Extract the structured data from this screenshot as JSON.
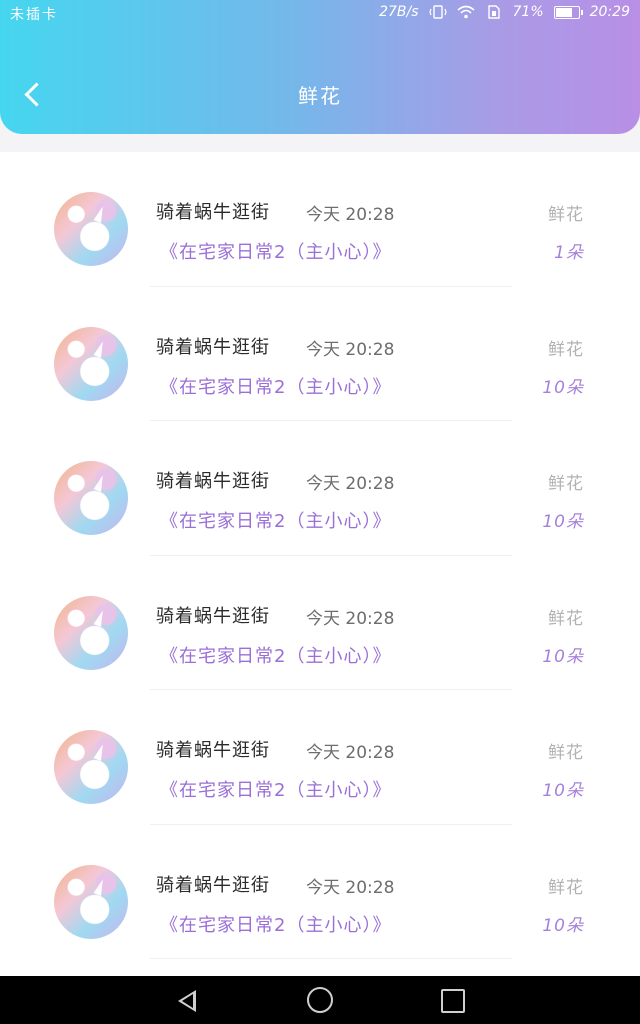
{
  "status_bar": {
    "carrier": "未插卡",
    "net_speed": "27B/s",
    "battery_percent": "71%",
    "time": "20:29",
    "icons": [
      "vibrate-icon",
      "wifi-icon",
      "sim-icon",
      "battery-icon"
    ]
  },
  "header": {
    "title": "鲜花",
    "gradient": [
      "#45d6ef",
      "#b88fe5"
    ]
  },
  "list": [
    {
      "name": "骑着蜗牛逛街",
      "time": "今天  20:28",
      "book": "《在宅家日常2（主小心）》",
      "gift_label": "鲜花",
      "gift_count": "1朵"
    },
    {
      "name": "骑着蜗牛逛街",
      "time": "今天  20:28",
      "book": "《在宅家日常2（主小心）》",
      "gift_label": "鲜花",
      "gift_count": "10朵"
    },
    {
      "name": "骑着蜗牛逛街",
      "time": "今天  20:28",
      "book": "《在宅家日常2（主小心）》",
      "gift_label": "鲜花",
      "gift_count": "10朵"
    },
    {
      "name": "骑着蜗牛逛街",
      "time": "今天  20:28",
      "book": "《在宅家日常2（主小心）》",
      "gift_label": "鲜花",
      "gift_count": "10朵"
    },
    {
      "name": "骑着蜗牛逛街",
      "time": "今天  20:28",
      "book": "《在宅家日常2（主小心）》",
      "gift_label": "鲜花",
      "gift_count": "10朵"
    },
    {
      "name": "骑着蜗牛逛街",
      "time": "今天  20:28",
      "book": "《在宅家日常2（主小心）》",
      "gift_label": "鲜花",
      "gift_count": "10朵"
    }
  ],
  "colors": {
    "accent_purple": "#9a6fd7",
    "count_purple": "#a681dc"
  },
  "nav_bar": {
    "icons": [
      "nav-back-icon",
      "nav-home-icon",
      "nav-recent-icon"
    ]
  }
}
